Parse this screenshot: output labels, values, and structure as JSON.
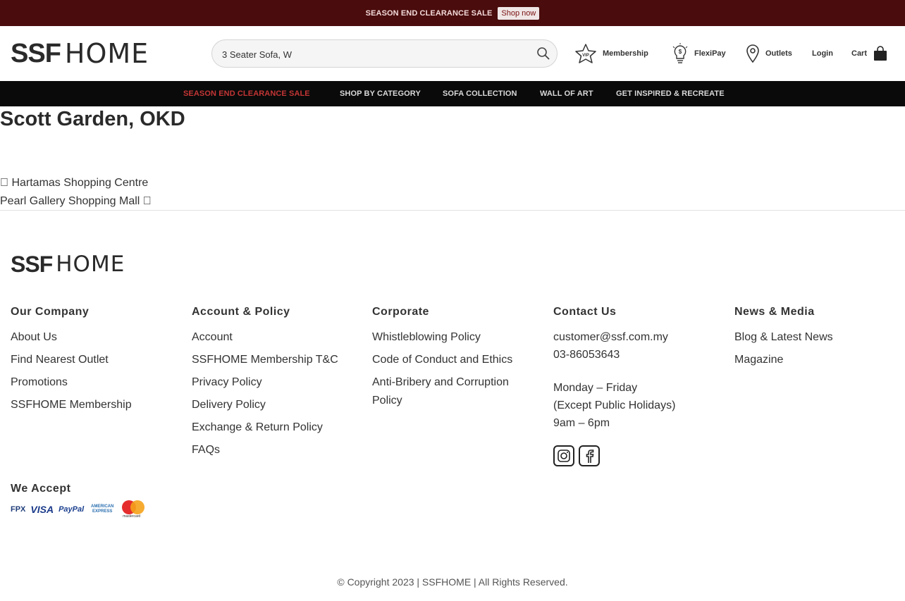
{
  "topbar": {
    "promo_text": "SEASON END CLEARANCE SALE",
    "cta_label": "Shop now",
    "bg_color": "#4a0c0c"
  },
  "header": {
    "logo": {
      "part1": "SSF",
      "part2": "HOME"
    },
    "search": {
      "value": "3 Seater Sofa, W",
      "icon": "search-icon"
    },
    "links": {
      "membership": "Membership",
      "flexipay": "FlexiPay",
      "outlets": "Outlets",
      "login": "Login",
      "cart": "Cart"
    }
  },
  "mainnav": {
    "items": [
      "SEASON END CLEARANCE SALE",
      "SHOP BY CATEGORY",
      "SOFA COLLECTION",
      "WALL OF ART",
      "GET INSPIRED & RECREATE"
    ],
    "sale_color": "#c43535"
  },
  "page": {
    "title": "Scott Garden, OKD",
    "prev_link": " Hartamas Shopping Centre",
    "next_link": "Pearl Gallery Shopping Mall "
  },
  "footer": {
    "logo": {
      "part1": "SSF",
      "part2": "HOME"
    },
    "columns": {
      "company": {
        "heading": "Our Company",
        "links": [
          "About Us",
          "Find Nearest Outlet",
          "Promotions",
          "SSFHOME Membership"
        ]
      },
      "account": {
        "heading": "Account & Policy",
        "links": [
          "Account",
          "SSFHOME Membership T&C",
          "Privacy Policy",
          "Delivery Policy",
          "Exchange & Return Policy",
          "FAQs"
        ]
      },
      "corporate": {
        "heading": "Corporate",
        "links": [
          "Whistleblowing Policy",
          "Code of Conduct and Ethics",
          "Anti-Bribery and Corruption Policy"
        ]
      },
      "contact": {
        "heading": "Contact Us",
        "email": "customer@ssf.com.my",
        "phone": "03-86053643",
        "hours_line1": "Monday – Friday",
        "hours_line2": "(Except Public Holidays)",
        "hours_line3": "9am – 6pm"
      },
      "news": {
        "heading": "News & Media",
        "links": [
          "Blog & Latest News",
          "Magazine"
        ]
      }
    },
    "social_icons": [
      "instagram-icon",
      "facebook-icon"
    ],
    "we_accept": "We Accept",
    "payment_methods": [
      "FPX",
      "VISA",
      "PayPal",
      "AMERICAN EXPRESS",
      "mastercard"
    ],
    "copyright": "© Copyright 2023 | SSFHOME | All Rights Reserved."
  }
}
